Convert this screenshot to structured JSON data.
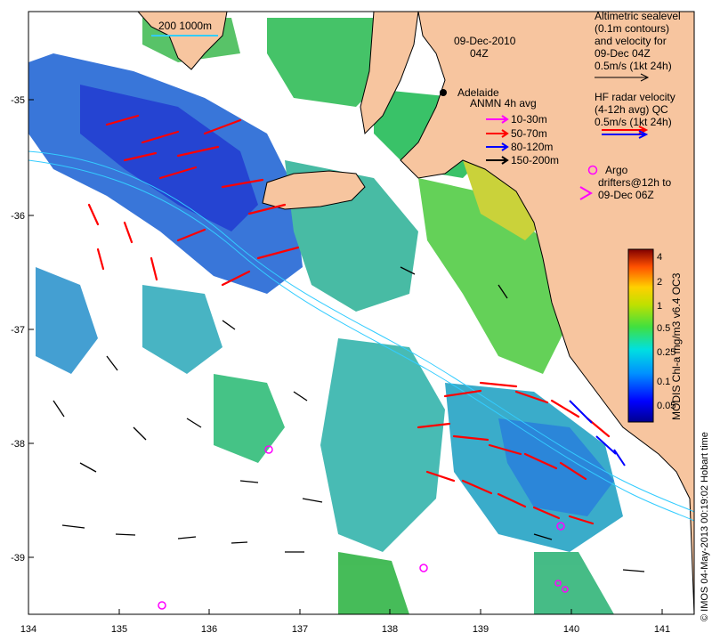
{
  "header": {
    "date": "09-Dec-2010",
    "time": "04Z"
  },
  "scale_bar": {
    "label": "200  1000m"
  },
  "city": {
    "name": "Adelaide"
  },
  "altimetry_legend": {
    "lines": [
      "Altimetric sealevel",
      "(0.1m contours)",
      "and velocity for",
      "09-Dec 04Z",
      "0.5m/s (1kt 24h)"
    ]
  },
  "hf_radar_legend": {
    "lines": [
      "HF radar velocity",
      "(4-12h avg) QC",
      "0.5m/s (1kt 24h)"
    ]
  },
  "anmn_legend": {
    "title": "ANMN 4h avg",
    "items": [
      {
        "label": "10-30m",
        "color": "#ff00ff"
      },
      {
        "label": "50-70m",
        "color": "#ff0000"
      },
      {
        "label": "80-120m",
        "color": "#0000ff"
      },
      {
        "label": "150-200m",
        "color": "#000000"
      }
    ]
  },
  "argo_legend": {
    "lines": [
      "Argo",
      "drifters@12h to",
      "09-Dec 06Z"
    ],
    "color": "#ff00ff"
  },
  "colorbar": {
    "title": "MODIS Chl-a mg/m3 v6.4 OC3",
    "ticks": [
      "4",
      "2",
      "1",
      "0.5",
      "0.25",
      "0.1",
      "0.05"
    ]
  },
  "credit": {
    "text": "© IMOS 04-May-2013 00:19:02 Hobart time"
  },
  "axes": {
    "x_ticks": [
      "134",
      "135",
      "136",
      "137",
      "138",
      "139",
      "140",
      "141"
    ],
    "y_ticks": [
      "-35",
      "-36",
      "-37",
      "-38",
      "-39"
    ]
  },
  "colors": {
    "land": "#f7c59f",
    "ocean": "#ffffff",
    "current_arrow": "#ff0000",
    "wind_arrow": "#000000",
    "argo": "#ff00ff",
    "isobath": "#33ccff"
  }
}
